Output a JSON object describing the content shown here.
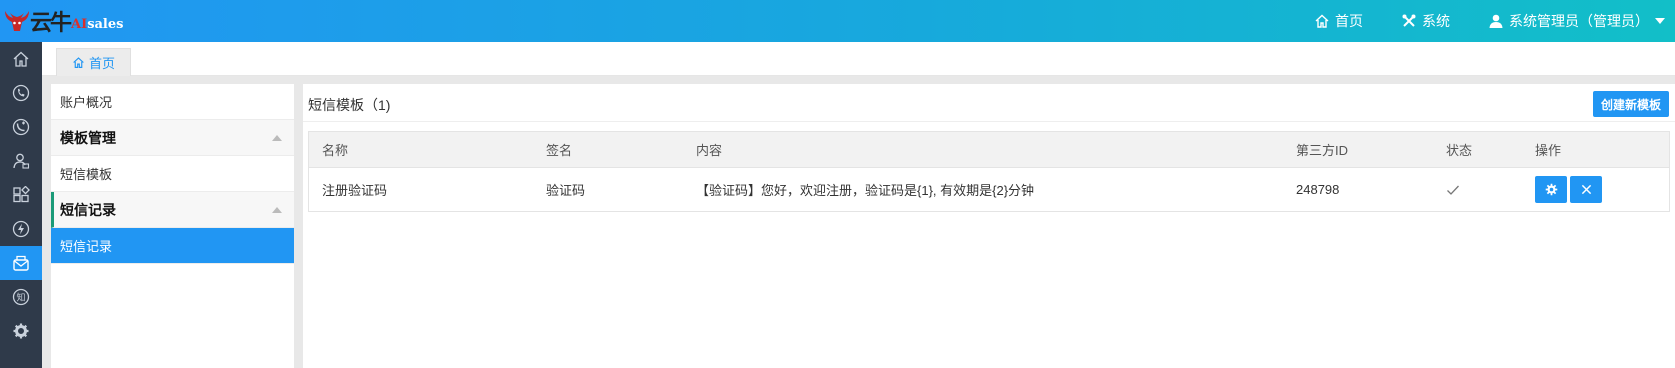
{
  "header": {
    "logo": {
      "cn": "云牛",
      "ai": "AI",
      "sales": "sales"
    },
    "nav": [
      {
        "label": "首页",
        "icon": "home-icon"
      },
      {
        "label": "系统",
        "icon": "tools-icon"
      },
      {
        "label": "系统管理员（管理员）",
        "icon": "user-icon"
      }
    ]
  },
  "rail": {
    "icons": [
      "home-icon",
      "phone-icon",
      "call-log-icon",
      "contacts-icon",
      "apps-icon",
      "flash-icon",
      "sms-icon",
      "knowledge-icon",
      "gear-icon"
    ],
    "knowledge_glyph": "知",
    "active_index": 6
  },
  "tabs": [
    {
      "label": "首页"
    }
  ],
  "submenu": {
    "items": [
      {
        "label": "账户概况",
        "type": "item"
      },
      {
        "label": "模板管理",
        "type": "group"
      },
      {
        "label": "短信模板",
        "type": "item"
      },
      {
        "label": "短信记录",
        "type": "group"
      },
      {
        "label": "短信记录",
        "type": "item",
        "selected": true
      }
    ]
  },
  "main": {
    "title": "短信模板（1)",
    "create_button": "创建新模板",
    "table": {
      "columns": [
        "名称",
        "签名",
        "内容",
        "第三方ID",
        "状态",
        "操作"
      ],
      "rows": [
        {
          "name": "注册验证码",
          "signature": "验证码",
          "content": "【验证码】您好，欢迎注册，验证码是{1}, 有效期是{2}分钟",
          "third_party_id": "248798",
          "status_icon": "check-icon"
        }
      ]
    }
  },
  "colors": {
    "accent": "#2196f3",
    "rail": "#2f3a4a",
    "group_marker": "#1a9a78"
  }
}
